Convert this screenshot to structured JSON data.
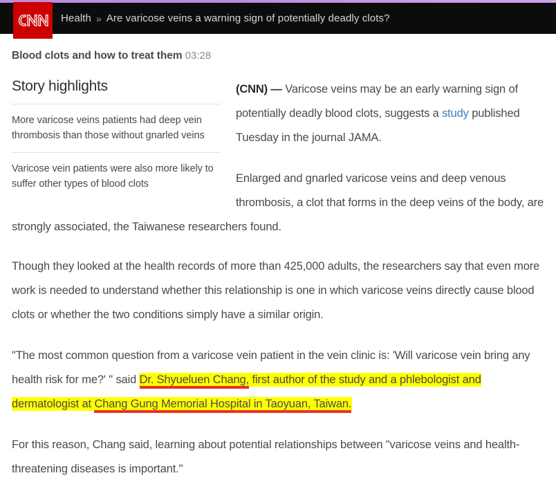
{
  "header": {
    "logo_alt": "CNN",
    "breadcrumb_section": "Health",
    "breadcrumb_separator": "»",
    "breadcrumb_title": "Are varicose veins a warning sign of potentially deadly clots?"
  },
  "video": {
    "title": "Blood clots and how to treat them",
    "duration": "03:28"
  },
  "highlights": {
    "title": "Story highlights",
    "items": [
      "More varicose veins patients had deep vein thrombosis than those without gnarled veins",
      "Varicose vein patients were also more likely to suffer other types of blood clots"
    ]
  },
  "article": {
    "p1_source": "(CNN) —",
    "p1_text_a": " Varicose veins may be an early warning sign of potentially deadly blood clots, suggests a ",
    "p1_link": "study",
    "p1_text_b": " published Tuesday in the journal JAMA.",
    "p2": "Enlarged and gnarled varicose veins and deep venous thrombosis, a clot that forms in the deep veins of the body, are strongly associated, the Taiwanese researchers found.",
    "p3": "Though they looked at the health records of more than 425,000 adults, the researchers say that even more work is needed to understand whether this relationship is one in which varicose veins directly cause blood clots or whether the two conditions simply have a similar origin.",
    "p4_text_a": "\"The most common question from a varicose vein patient in the vein clinic is: 'Will varicose vein bring any health risk for me?' \" said ",
    "p4_highlight_1": "Dr. Shyueluen Chang,",
    "p4_highlight_2": " first author of the study and a phlebologist and dermatologist at ",
    "p4_highlight_3": "Chang Gung Memorial Hospital in Taoyuan, Taiwan.",
    "p5": "For this reason, Chang said, learning about potential relationships between \"varicose veins and health-threatening diseases is important.\""
  },
  "colors": {
    "brand_red": "#cc0000",
    "header_black": "#0c0c0c",
    "link_blue": "#3b7dbf",
    "highlight_yellow": "#ffff00",
    "annotation_red": "#ea3323",
    "top_strip_purple": "#c08ee0"
  }
}
